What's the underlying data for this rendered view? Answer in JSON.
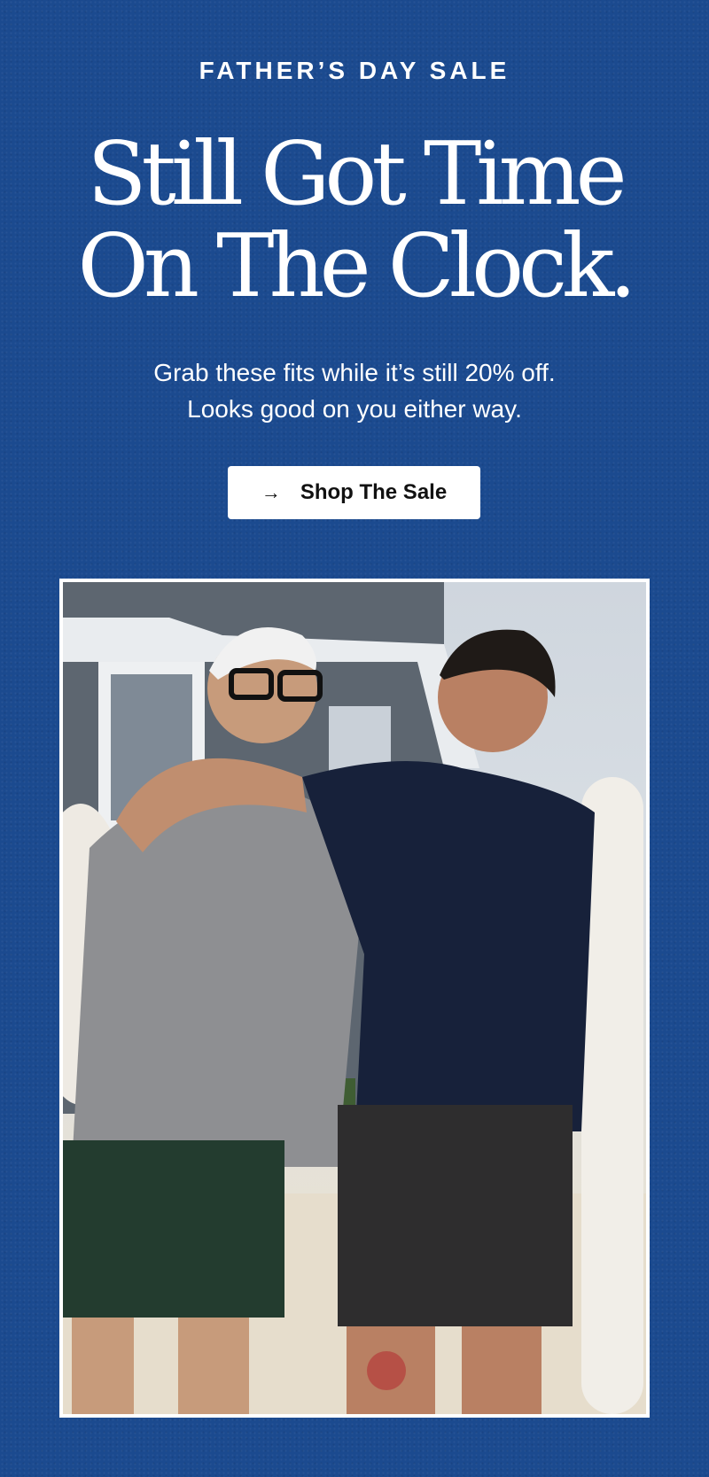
{
  "hero": {
    "eyebrow": "FATHER’S DAY SALE",
    "headline_line1": "Still Got Time",
    "headline_line2": "On The Clock.",
    "subtext_line1": "Grab these fits while it’s still 20% off.",
    "subtext_line2": "Looks good on you either way."
  },
  "cta": {
    "label": "Shop The Sale",
    "icon": "arrow-right-icon"
  },
  "colors": {
    "background": "#1b4a8f",
    "button_bg": "#ffffff",
    "button_text": "#111111",
    "text": "#ffffff"
  }
}
